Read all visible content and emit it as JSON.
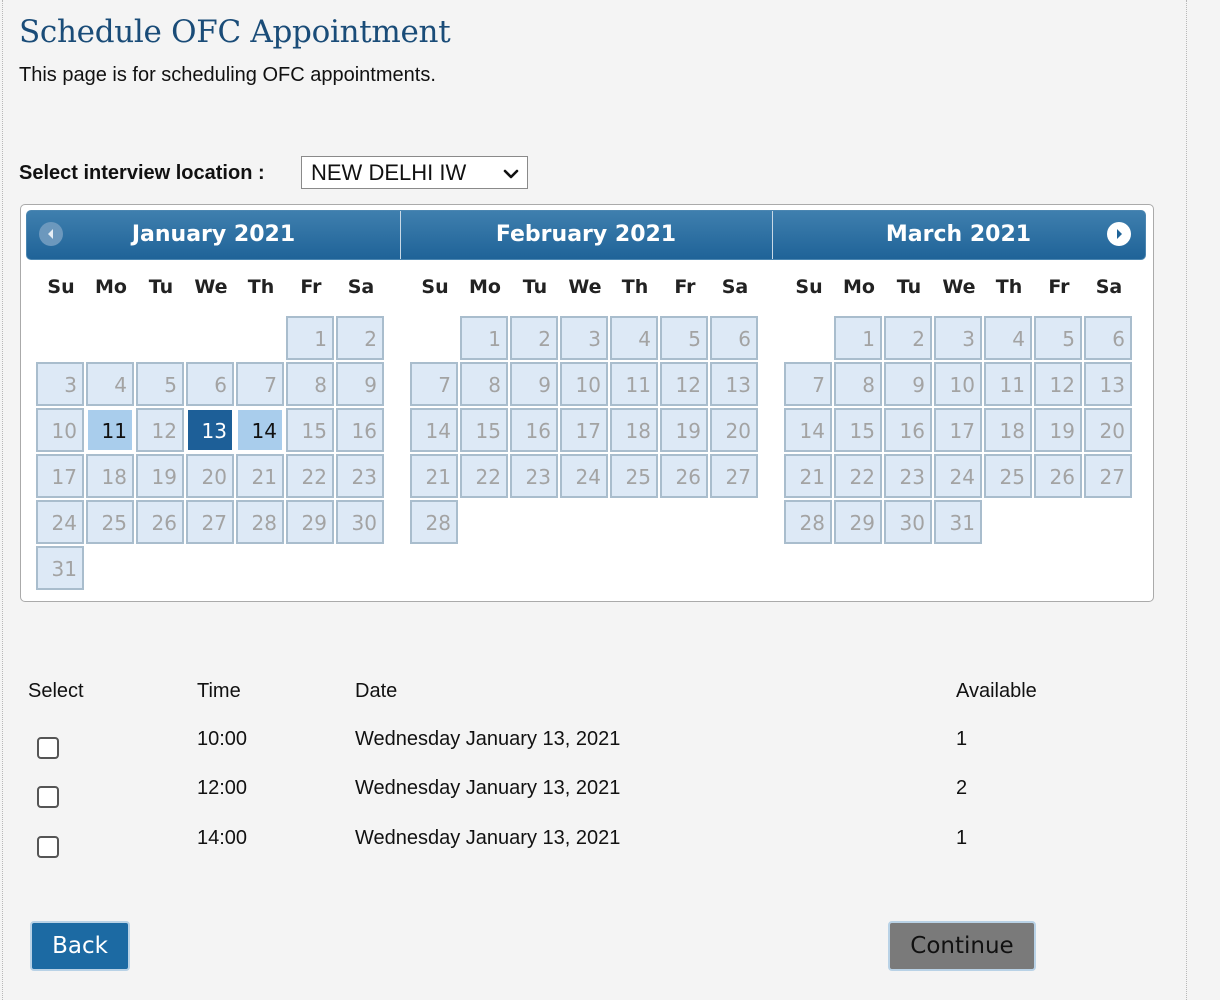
{
  "page": {
    "title": "Schedule OFC Appointment",
    "description": "This page is for scheduling OFC appointments."
  },
  "location": {
    "label": "Select interview location :",
    "selected": "NEW DELHI IW"
  },
  "calendar": {
    "weekdays": [
      "Su",
      "Mo",
      "Tu",
      "We",
      "Th",
      "Fr",
      "Sa"
    ],
    "prev_icon": "chevron-left-circle-icon",
    "next_icon": "chevron-right-circle-icon",
    "months": [
      {
        "title": "January 2021",
        "first_weekday": 5,
        "days": 31,
        "available": [
          11,
          14
        ],
        "selected": 13
      },
      {
        "title": "February 2021",
        "first_weekday": 1,
        "days": 28,
        "available": [],
        "selected": null
      },
      {
        "title": "March 2021",
        "first_weekday": 1,
        "days": 31,
        "available": [],
        "selected": null
      }
    ]
  },
  "colors": {
    "header_blue": "#1f6398",
    "available_day": "#a9cdec",
    "selected_day": "#1d5f98",
    "unavailable_day": "#dde9f6",
    "title_blue": "#1a4c78"
  },
  "slots": {
    "headers": {
      "select": "Select",
      "time": "Time",
      "date": "Date",
      "available": "Available"
    },
    "rows": [
      {
        "time": "10:00",
        "date": "Wednesday January 13, 2021",
        "available": "1"
      },
      {
        "time": "12:00",
        "date": "Wednesday January 13, 2021",
        "available": "2"
      },
      {
        "time": "14:00",
        "date": "Wednesday January 13, 2021",
        "available": "1"
      }
    ]
  },
  "buttons": {
    "back": "Back",
    "continue": "Continue"
  }
}
